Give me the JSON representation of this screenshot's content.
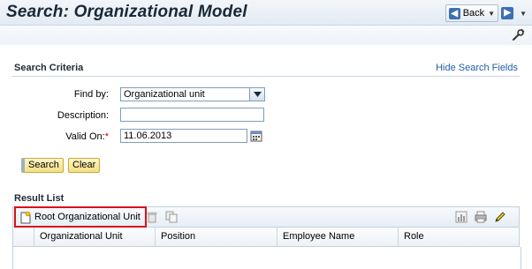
{
  "header": {
    "title": "Search: Organizational Model",
    "back_label": "Back"
  },
  "search_criteria": {
    "title": "Search Criteria",
    "hide_link": "Hide Search Fields",
    "find_by_label": "Find by:",
    "find_by_value": "Organizational unit",
    "description_label": "Description:",
    "description_value": "",
    "valid_on_label": "Valid On:",
    "valid_on_required": "*",
    "valid_on_value": "11.06.2013",
    "search_button": "Search",
    "clear_button": "Clear"
  },
  "result_list": {
    "title": "Result List",
    "root_button": "Root Organizational Unit",
    "columns": [
      "Organizational Unit",
      "Position",
      "Employee Name",
      "Role"
    ]
  },
  "colors": {
    "highlight": "#d8101a",
    "link": "#1f5ea8",
    "button_yellow": "#f4df80"
  }
}
